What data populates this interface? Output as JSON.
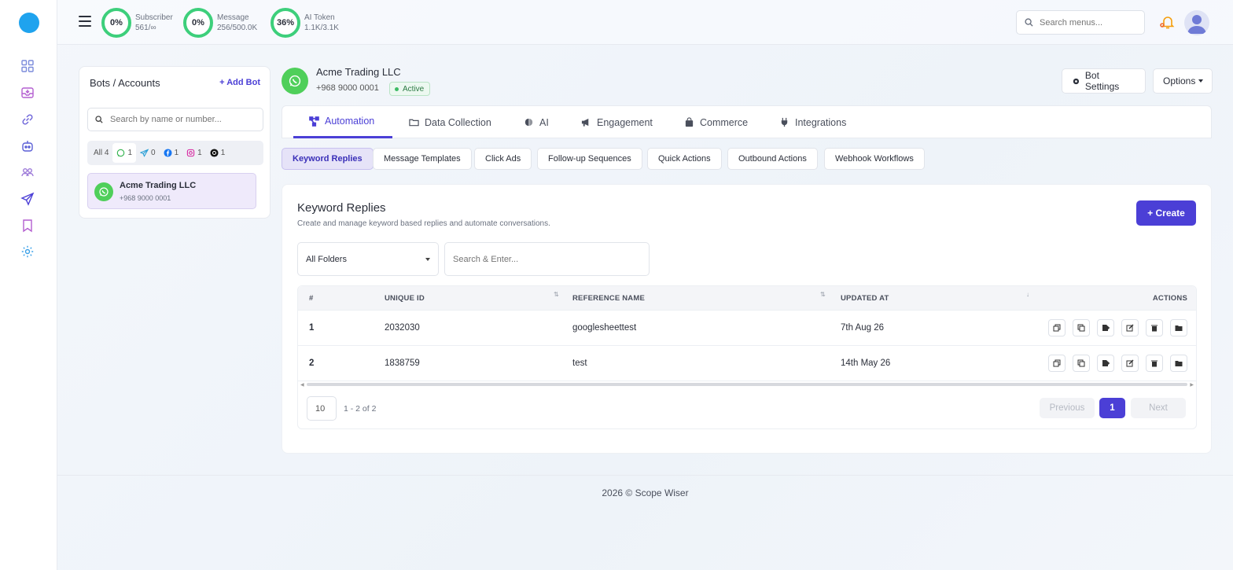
{
  "stats": [
    {
      "percent": "0%",
      "label": "Subscriber",
      "value": "561/∞"
    },
    {
      "percent": "0%",
      "label": "Message",
      "value": "256/500.0K"
    },
    {
      "percent": "36%",
      "label": "AI Token",
      "value": "1.1K/3.1K"
    }
  ],
  "header": {
    "search_placeholder": "Search menus..."
  },
  "bots": {
    "title": "Bots / Accounts",
    "add_label": "+ Add Bot",
    "search_placeholder": "Search by name or number...",
    "filters": [
      {
        "label": "All",
        "count": "4"
      },
      {
        "icon": "whatsapp-icon",
        "count": "1"
      },
      {
        "icon": "telegram-icon",
        "count": "0"
      },
      {
        "icon": "facebook-icon",
        "count": "1"
      },
      {
        "icon": "instagram-icon",
        "count": "1"
      },
      {
        "icon": "threads-icon",
        "count": "1"
      }
    ],
    "items": [
      {
        "name": "Acme Trading LLC",
        "number": "+968 9000 0001"
      }
    ]
  },
  "account": {
    "name": "Acme Trading LLC",
    "number": "+968 9000 0001",
    "status": "Active",
    "bot_settings_label": "Bot Settings",
    "options_label": "Options"
  },
  "tabs": [
    {
      "label": "Automation",
      "icon": "flow-icon"
    },
    {
      "label": "Data Collection",
      "icon": "folder-icon"
    },
    {
      "label": "AI",
      "icon": "brain-icon"
    },
    {
      "label": "Engagement",
      "icon": "megaphone-icon"
    },
    {
      "label": "Commerce",
      "icon": "bag-icon"
    },
    {
      "label": "Integrations",
      "icon": "plug-icon"
    }
  ],
  "subtabs": [
    "Keyword Replies",
    "Message Templates",
    "Click Ads",
    "Follow-up Sequences",
    "Quick Actions",
    "Outbound Actions",
    "Webhook Workflows"
  ],
  "content": {
    "title": "Keyword Replies",
    "subtitle": "Create and manage keyword based replies and automate conversations.",
    "create_label": "+ Create",
    "folder_select": "All Folders",
    "search_placeholder": "Search & Enter..."
  },
  "table": {
    "columns": [
      "#",
      "UNIQUE ID",
      "REFERENCE NAME",
      "UPDATED AT",
      "ACTIONS"
    ],
    "rows": [
      {
        "idx": "1",
        "id": "2032030",
        "name": "googlesheettest",
        "updated": "7th Aug 26"
      },
      {
        "idx": "2",
        "id": "1838759",
        "name": "test",
        "updated": "14th May 26"
      }
    ]
  },
  "pagination": {
    "page_size": "10",
    "range": "1 - 2 of 2",
    "previous": "Previous",
    "current": "1",
    "next": "Next"
  },
  "footer": "2026 © Scope Wiser",
  "colors": {
    "accent": "#4b3fd6",
    "whatsapp": "#4fcf5a",
    "ring": "#3dcf7b",
    "logo": "#1fa3ee"
  }
}
